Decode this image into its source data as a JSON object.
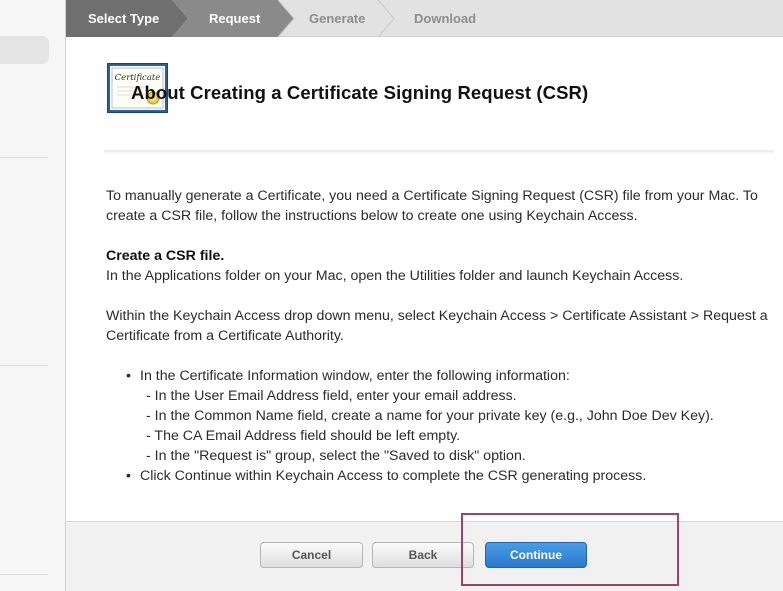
{
  "steps": [
    {
      "label": "Select Type",
      "state": "done"
    },
    {
      "label": "Request",
      "state": "current"
    },
    {
      "label": "Generate",
      "state": "todo"
    },
    {
      "label": "Download",
      "state": "todo"
    }
  ],
  "header": {
    "icon_caption": "Certificate",
    "title": "About Creating a Certificate Signing Request (CSR)"
  },
  "body": {
    "intro": "To manually generate a Certificate, you need a Certificate Signing Request (CSR) file from your Mac. To create a CSR file, follow the instructions below to create one using Keychain Access.",
    "section_heading": "Create a CSR file.",
    "section_text": "In the Applications folder on your Mac, open the Utilities folder and launch Keychain Access.",
    "menu_instruction": "Within the Keychain Access drop down menu, select Keychain Access > Certificate Assistant > Request a Certificate from a Certificate Authority.",
    "bullet1": "In the Certificate Information window, enter the following information:",
    "sub_items": [
      "- In the User Email Address field, enter your email address.",
      "- In the Common Name field, create a name for your private key (e.g., John Doe Dev Key).",
      "- The CA Email Address field should be left empty.",
      "- In the \"Request is\" group, select the \"Saved to disk\" option."
    ],
    "bullet2": "Click Continue within Keychain Access to complete the CSR generating process.",
    "bullet_char": "•"
  },
  "footer": {
    "cancel_label": "Cancel",
    "back_label": "Back",
    "continue_label": "Continue"
  },
  "colors": {
    "step_done": "#6f6f6f",
    "step_current": "#8a8a8a",
    "step_todo": "#e2e2e2",
    "primary_button": "#2a78cf",
    "highlight": "#a0416a"
  }
}
